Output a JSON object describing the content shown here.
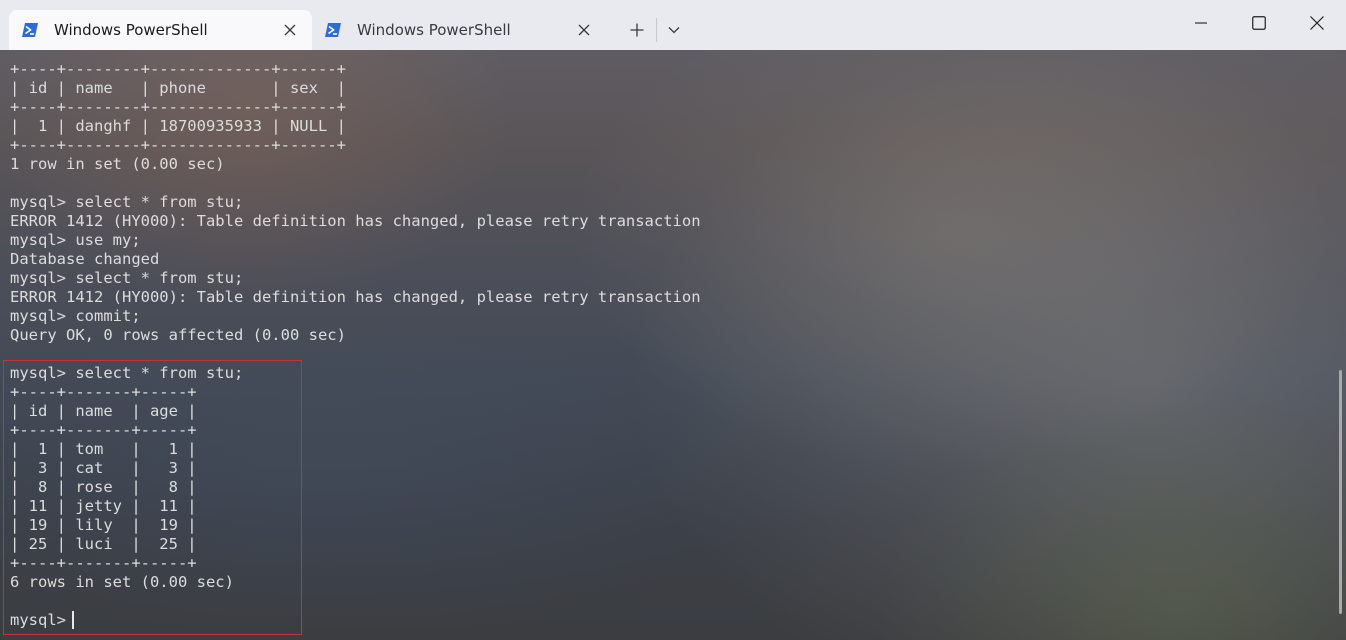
{
  "tabs": [
    {
      "title": "Windows PowerShell",
      "active": true
    },
    {
      "title": "Windows PowerShell",
      "active": false
    }
  ],
  "toolbar": {
    "new_tab_icon": "plus-icon",
    "dropdown_icon": "chevron-down-icon"
  },
  "window_controls": [
    "minimize-icon",
    "maximize-icon",
    "close-icon"
  ],
  "terminal": {
    "lines": [
      "+----+--------+-------------+------+",
      "| id | name   | phone       | sex  |",
      "+----+--------+-------------+------+",
      "|  1 | danghf | 18700935933 | NULL |",
      "+----+--------+-------------+------+",
      "1 row in set (0.00 sec)",
      "",
      "mysql> select * from stu;",
      "ERROR 1412 (HY000): Table definition has changed, please retry transaction",
      "mysql> use my;",
      "Database changed",
      "mysql> select * from stu;",
      "ERROR 1412 (HY000): Table definition has changed, please retry transaction",
      "mysql> commit;",
      "Query OK, 0 rows affected (0.00 sec)",
      "",
      "mysql> select * from stu;",
      "+----+-------+-----+",
      "| id | name  | age |",
      "+----+-------+-----+",
      "|  1 | tom   |   1 |",
      "|  3 | cat   |   3 |",
      "|  8 | rose  |   8 |",
      "| 11 | jetty |  11 |",
      "| 19 | lily  |  19 |",
      "| 25 | luci  |  25 |",
      "+----+-------+-----+",
      "6 rows in set (0.00 sec)",
      "",
      "mysql> "
    ]
  },
  "colors": {
    "titlebar_bg": "#e9eaef",
    "active_tab_bg": "#f9f9fb",
    "powershell_icon": "#2f6bd6",
    "terminal_text": "#dcdcdc",
    "highlight_border": "#c8313a"
  }
}
